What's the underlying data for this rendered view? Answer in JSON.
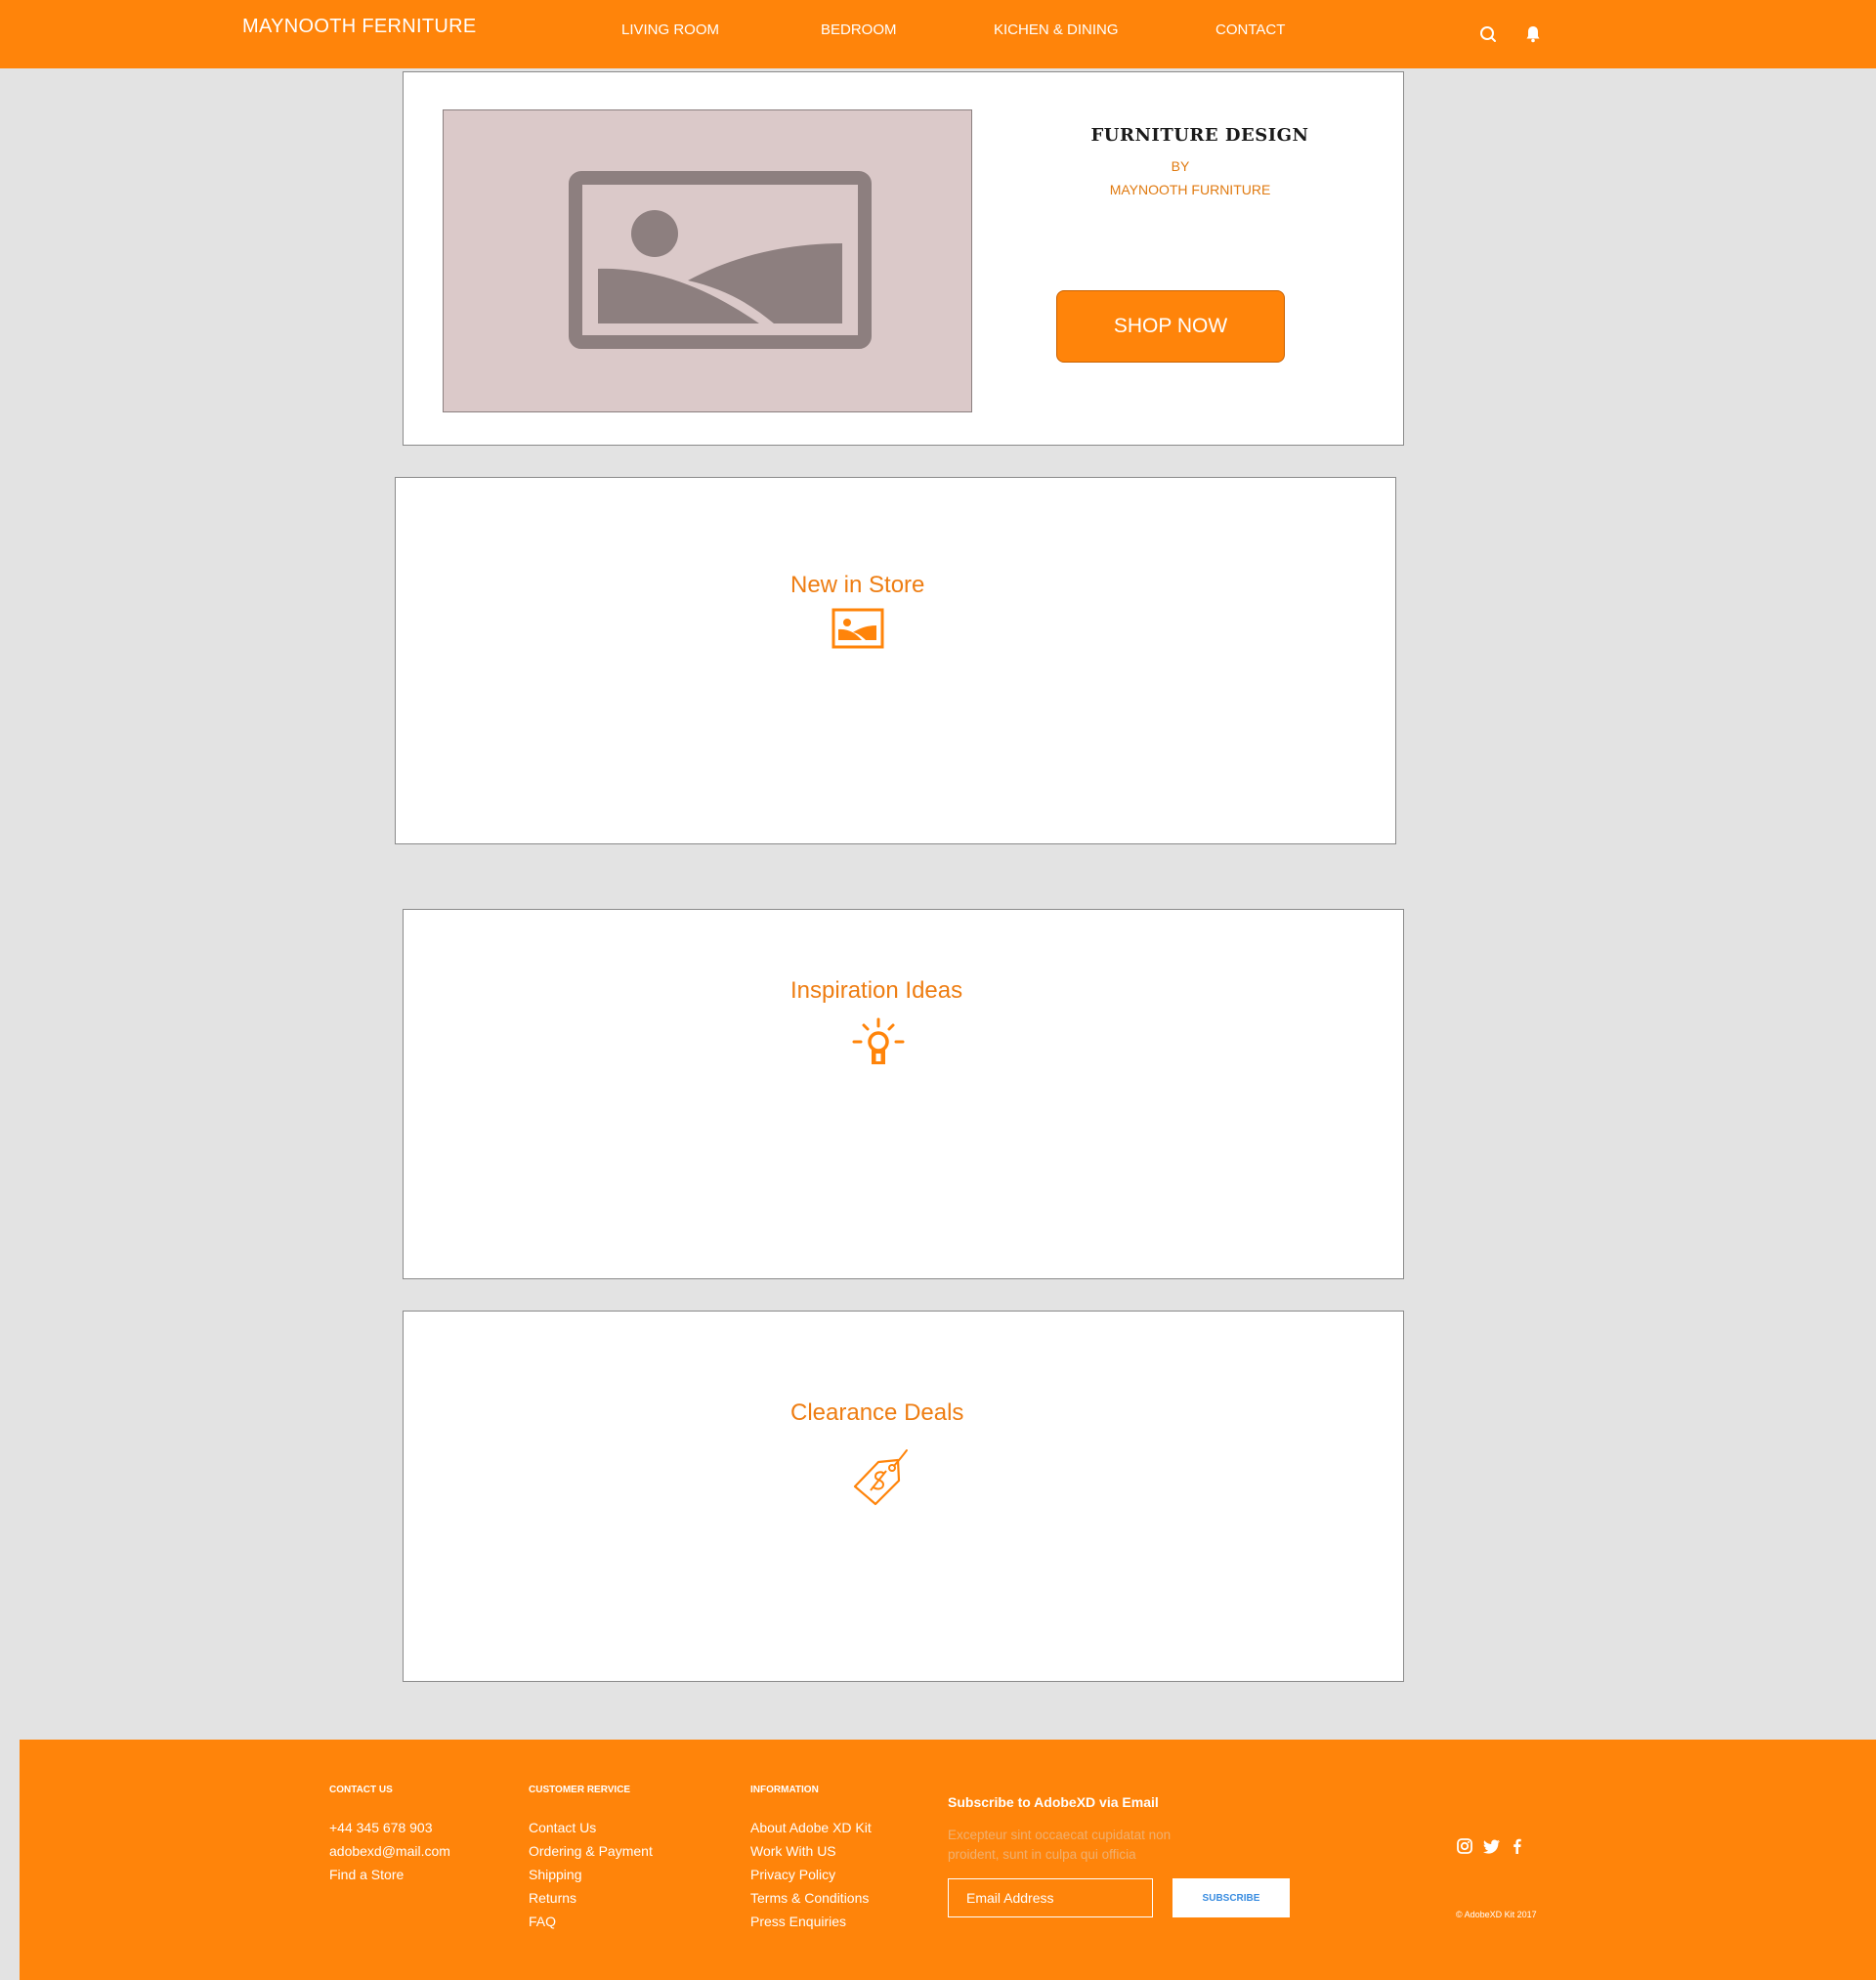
{
  "nav": {
    "brand": "MAYNOOTH FERNITURE",
    "links": [
      "LIVING ROOM",
      "BEDROOM",
      "KICHEN & DINING",
      "CONTACT"
    ],
    "icons": [
      "search-icon",
      "bell-icon"
    ]
  },
  "hero": {
    "title": "FURNITURE DESIGN",
    "by": "BY",
    "company": "MAYNOOTH FURNITURE",
    "button": "SHOP NOW",
    "image_icon": "image-placeholder-icon"
  },
  "sections": [
    {
      "title": "New in Store",
      "icon": "image-icon"
    },
    {
      "title": "Inspiration Ideas",
      "icon": "lightbulb-icon"
    },
    {
      "title": "Clearance Deals",
      "icon": "price-tag-icon"
    }
  ],
  "footer": {
    "contact": {
      "heading": "CONTACT US",
      "phone": "+44 345 678 903",
      "email": "adobexd@mail.com",
      "store": "Find a Store"
    },
    "customer_service": {
      "heading": "CUSTOMER RERVICE",
      "links": [
        "Contact Us",
        "Ordering & Payment",
        "Shipping",
        "Returns",
        "FAQ"
      ]
    },
    "information": {
      "heading": "INFORMATION",
      "links": [
        "About Adobe XD Kit",
        "Work With US",
        "Privacy Policy",
        "Terms & Conditions",
        "Press Enquiries"
      ]
    },
    "subscribe": {
      "title": "Subscribe to AdobeXD via Email",
      "text": "Excepteur sint occaecat cupidatat non proident, sunt in culpa qui officia",
      "placeholder": "Email Address",
      "button": "SUBSCRIBE"
    },
    "social": [
      "instagram-icon",
      "twitter-icon",
      "facebook-icon"
    ],
    "copyright": "© AdobeXD Kit 2017"
  },
  "colors": {
    "accent": "#ff840a",
    "accent_text": "#ee7d12",
    "background": "#e3e3e3",
    "placeholder_bg": "#dbc9c9",
    "placeholder_icon": "#8d7f7f"
  }
}
